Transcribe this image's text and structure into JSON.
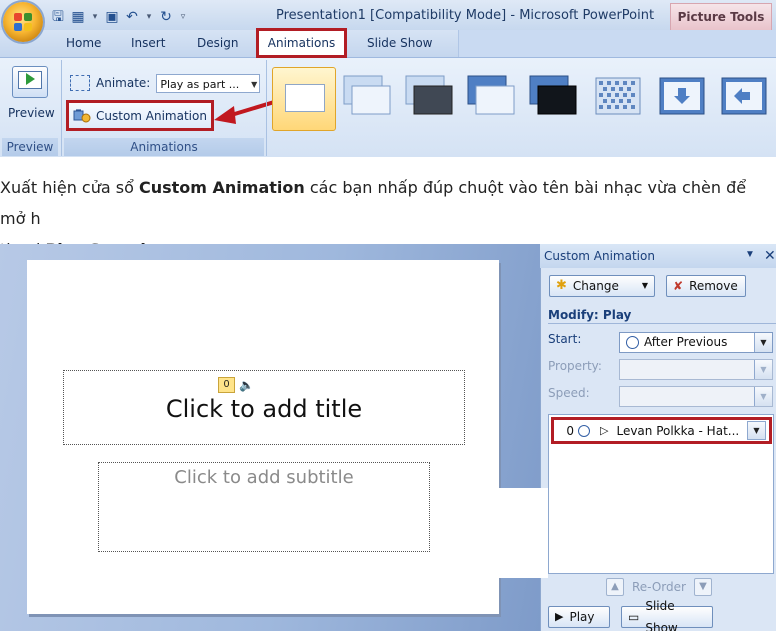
{
  "top_screenshot": {
    "window_title": "Presentation1 [Compatibility Mode] - Microsoft PowerPoint",
    "contextual_tab": "Picture Tools",
    "tabs": [
      "Home",
      "Insert",
      "Design",
      "Animations",
      "Slide Show"
    ],
    "active_tab": "Animations",
    "preview_button": "Preview",
    "animate_label": "Animate:",
    "animate_value": "Play as part ...",
    "custom_animation_button": "Custom Animation",
    "groups": [
      "Preview",
      "Animations"
    ],
    "highlight_color": "#b21d24",
    "transition_thumbnail_count": 8
  },
  "caption": {
    "line1_prefix": "Xuất hiện cửa sổ ",
    "line1_bold": "Custom Animation",
    "line1_suffix": " các bạn nhấp đúp chuột vào tên bài nhạc vừa chèn để mở h",
    "line2_prefix": "thoại ",
    "line2_bold": "Play Sound",
    "line2_suffix": "."
  },
  "slide_screenshot": {
    "slide": {
      "title_placeholder": "Click to add title",
      "subtitle_placeholder": "Click to add subtitle",
      "animation_index": "0"
    },
    "task_pane": {
      "title": "Custom Animation",
      "change_button": "Change",
      "remove_button": "Remove",
      "modify_label": "Modify: Play",
      "start_label": "Start:",
      "start_value": "After Previous",
      "property_label": "Property:",
      "speed_label": "Speed:",
      "list_item_index": "0",
      "list_item_name": "Levan Polkka - Hat...",
      "reorder_label": "Re-Order",
      "play_button": "Play",
      "slideshow_button": "Slide Show"
    }
  }
}
